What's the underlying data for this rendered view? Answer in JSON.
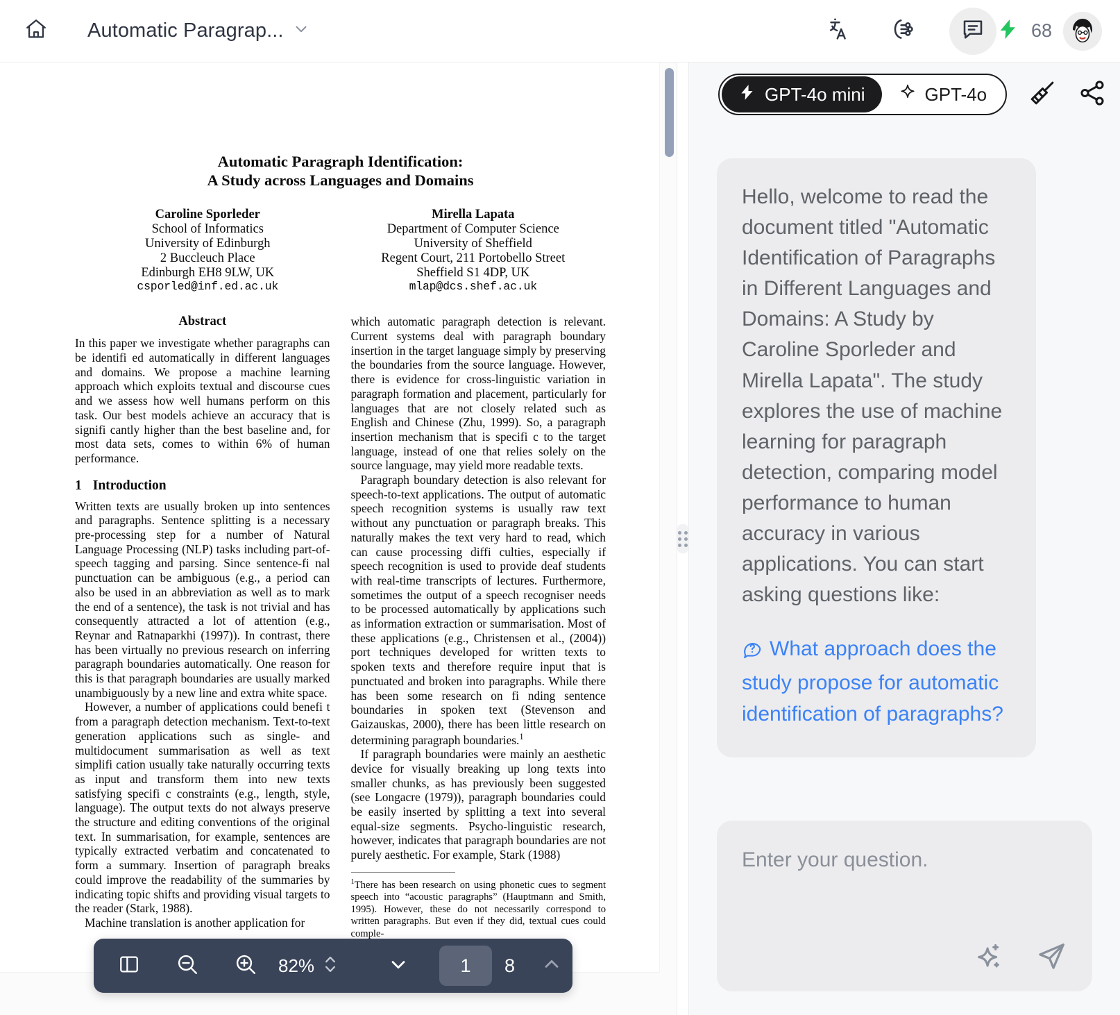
{
  "topbar": {
    "home_icon": "home-icon",
    "doc_title": "Automatic Paragrap...",
    "chevron_icon": "chevron-down-icon",
    "translate_icon": "translate-icon",
    "mindmap_icon": "mindmap-icon",
    "chat_icon": "chat-bubble-icon",
    "token_count": "68",
    "bolt_icon": "lightning-bolt-icon",
    "avatar": "user-avatar"
  },
  "pdf": {
    "scrollbar": "vertical-scrollbar",
    "toolbar": {
      "sidebar_toggle_icon": "sidebar-toggle-icon",
      "zoom_out_icon": "zoom-out-icon",
      "zoom_in_icon": "zoom-in-icon",
      "zoom_level": "82%",
      "zoom_stepper_icon": "zoom-stepper-icon",
      "prev_page_icon": "chevron-down-icon",
      "current_page": "1",
      "total_pages": "8",
      "next_page_icon": "chevron-up-icon"
    },
    "document": {
      "title_line1": "Automatic Paragraph Identification:",
      "title_line2": "A Study across Languages and Domains",
      "authors": [
        {
          "name": "Caroline Sporleder",
          "lines": [
            "School of Informatics",
            "University of Edinburgh",
            "2 Buccleuch Place",
            "Edinburgh EH8 9LW, UK"
          ],
          "email": "csporled@inf.ed.ac.uk"
        },
        {
          "name": "Mirella Lapata",
          "lines": [
            "Department of Computer Science",
            "University of Sheffield",
            "Regent Court, 211 Portobello Street",
            "Sheffield S1 4DP, UK"
          ],
          "email": "mlap@dcs.shef.ac.uk"
        }
      ],
      "abstract_heading": "Abstract",
      "abstract_text": "In this paper we investigate whether paragraphs can be identifi ed automatically in different languages and domains. We propose a machine learning approach which exploits textual and discourse cues and we assess how well humans perform on this task. Our best models achieve an accuracy that is signifi cantly higher than the best baseline and, for most data sets, comes to within 6% of human performance.",
      "intro_number": "1",
      "intro_heading": "Introduction",
      "intro_p1": "Written texts are usually broken up into sentences and paragraphs. Sentence splitting is a necessary pre-processing step for a number of Natural Language Processing (NLP) tasks including part-of-speech tagging and parsing. Since sentence-fi nal punctuation can be ambiguous (e.g., a period can also be used in an abbreviation as well as to mark the end of a sentence), the task is not trivial and has consequently attracted a lot of attention (e.g., Reynar and Ratnaparkhi (1997)). In contrast, there has been virtually no previous research on inferring paragraph boundaries automatically. One reason for this is that paragraph boundaries are usually marked unambiguously by a new line and extra white space.",
      "intro_p2": "However, a number of applications could benefi t from a paragraph detection mechanism. Text-to-text generation applications such as single- and multidocument summarisation as well as text simplifi cation usually take naturally occurring texts as input and transform them into new texts satisfying specifi c constraints (e.g., length, style, language). The output texts do not always preserve the structure and editing conventions of the original text. In summarisation, for example, sentences are typically extracted verbatim and concatenated to form a summary. Insertion of paragraph breaks could improve the readability of the summaries by indicating topic shifts and providing visual targets to the reader (Stark, 1988).",
      "intro_p3_clipped": "Machine translation is another application for",
      "right_p1": "which automatic paragraph detection is relevant. Current systems deal with paragraph boundary insertion in the target language simply by preserving the boundaries from the source language. However, there is evidence for cross-linguistic variation in paragraph formation and placement, particularly for languages that are not closely related such as English and Chinese (Zhu, 1999). So, a paragraph insertion mechanism that is specifi c to the target language, instead of one that relies solely on the source language, may yield more readable texts.",
      "right_p2": "Paragraph boundary detection is also relevant for speech-to-text applications. The output of automatic speech recognition systems is usually raw text without any punctuation or paragraph breaks. This naturally makes the text very hard to read, which can cause processing diffi culties, especially if speech recognition is used to provide deaf students with real-time transcripts of lectures. Furthermore, sometimes the output of a speech recogniser needs to be processed automatically by applications such as information extraction or summarisation. Most of these applications (e.g., Christensen et al., (2004)) port techniques developed for written texts to spoken texts and therefore require input that is punctuated and broken into paragraphs. While there has been some research on fi nding sentence boundaries in spoken text (Stevenson and Gaizauskas, 2000), there has been little research on determining paragraph boundaries.",
      "right_p2_footnote_marker": "1",
      "right_p3": "If paragraph boundaries were mainly an aesthetic device for visually breaking up long texts into smaller chunks, as has previously been suggested (see Longacre (1979)), paragraph boundaries could be easily inserted by splitting a text into several equal-size segments. Psycho-linguistic research, however, indicates that paragraph boundaries are not purely aesthetic. For example, Stark (1988)",
      "footnote_marker": "1",
      "footnote_text": "There has been research on using phonetic cues to segment speech into “acoustic paragraphs” (Hauptmann and Smith, 1995). However, these do not necessarily correspond to written paragraphs. But even if they did, textual cues could comple-"
    }
  },
  "divider": {
    "handle_icon": "drag-handle-icon"
  },
  "chat": {
    "models": [
      {
        "label": "GPT-4o mini",
        "icon": "lightning-bolt-icon",
        "selected": true
      },
      {
        "label": "GPT-4o",
        "icon": "sparkle-icon",
        "selected": false
      }
    ],
    "clear_icon": "broom-icon",
    "share_icon": "share-icon",
    "message": "Hello, welcome to read the document titled \"Automatic Identification of Paragraphs in Different Languages and Domains: A Study by Caroline Sporleder and Mirella Lapata\". The study explores the use of machine learning for paragraph detection, comparing model performance to human accuracy in various applications. You can start asking questions like:",
    "suggestion_icon": "question-bubble-icon",
    "suggestion": "What approach does the study propose for automatic identification of paragraphs?",
    "composer": {
      "placeholder": "Enter your question.",
      "magic_icon": "sparkle-plus-icon",
      "send_icon": "send-icon"
    }
  },
  "colors": {
    "accent_blue": "#3b82f6",
    "toolbar_bg": "#394459",
    "bolt_green": "#22c55e",
    "chat_bubble": "#ececee"
  }
}
